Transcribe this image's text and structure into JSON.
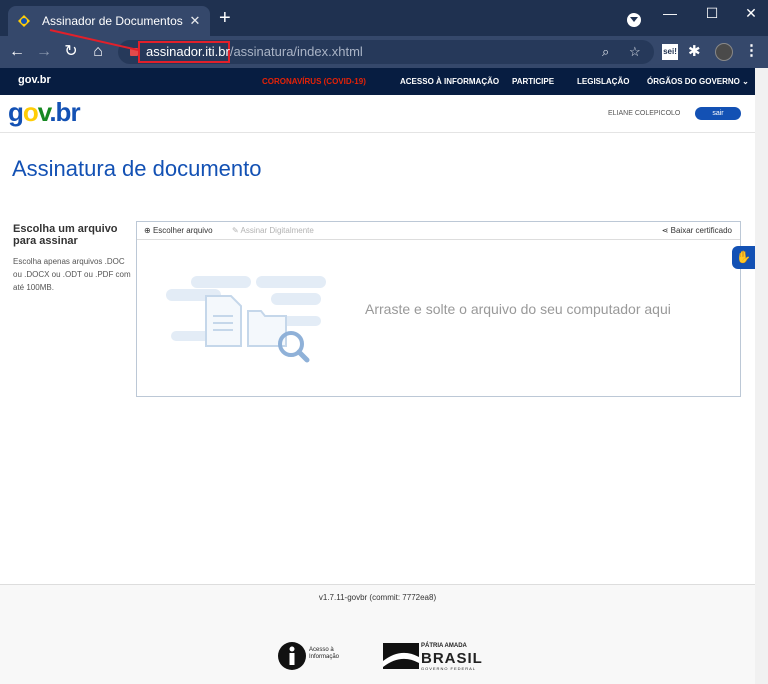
{
  "browser": {
    "tab_title": "Assinador de Documentos | Assin",
    "url_host": "assinador.iti.br",
    "url_path": "/assinatura/index.xhtml",
    "ext_label": "sei!"
  },
  "govbar": {
    "logo": "gov.br",
    "links": {
      "covid": "CORONAVÍRUS (COVID-19)",
      "info": "ACESSO À INFORMAÇÃO",
      "participe": "PARTICIPE",
      "legislacao": "LEGISLAÇÃO",
      "orgaos": "ÓRGÃOS DO GOVERNO"
    }
  },
  "header": {
    "logo": {
      "g": "g",
      "o": "o",
      "v": "v",
      "dot": ".",
      "b": "b",
      "r": "r"
    },
    "username": "ELIANE COLEPICOLO",
    "logout_label": "sair"
  },
  "main": {
    "title": "Assinatura de documento",
    "side_title": "Escolha um arquivo para assinar",
    "side_desc": "Escolha apenas arquivos .DOC ou .DOCX ou .ODT ou .PDF com até 100MB.",
    "choose_label": "Escolher arquivo",
    "sign_label": "Assinar Digitalmente",
    "cert_label": "Baixar certificado",
    "drop_text": "Arraste e solte o arquivo do seu computador aqui"
  },
  "footer": {
    "version": "v1.7.11-govbr (commit: 7772ea8)",
    "ai_line1": "Acesso à",
    "ai_line2": "Informação",
    "pab_small": "PÁTRIA AMADA",
    "pab_big": "BRASIL",
    "pab_sub": "GOVERNO FEDERAL"
  },
  "colors": {
    "primary": "#1351b4",
    "govbar_bg": "#071d41",
    "covid": "#e52207",
    "url_highlight": "#e2202a"
  }
}
